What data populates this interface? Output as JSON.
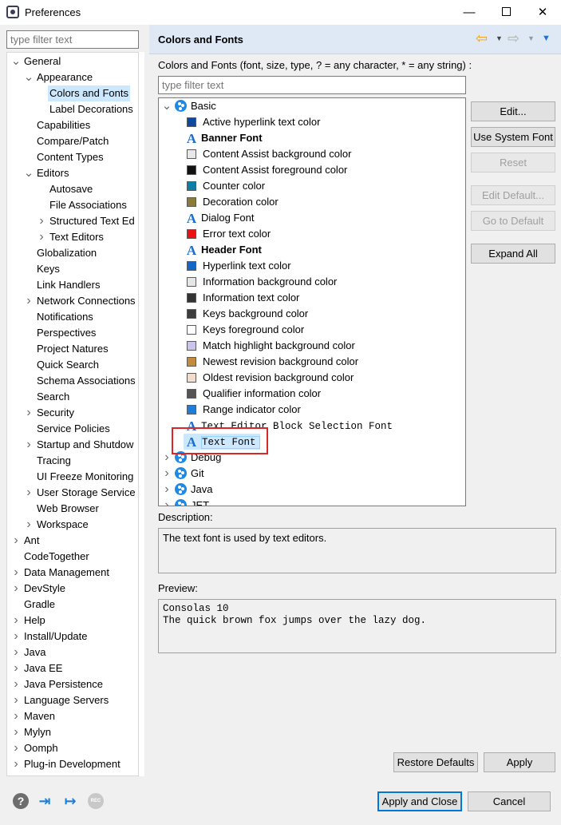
{
  "window": {
    "title": "Preferences",
    "minimize": "—",
    "close": "✕"
  },
  "left": {
    "filter_placeholder": "type filter text",
    "tree": [
      {
        "label": "General",
        "level": 0,
        "toggle": "open"
      },
      {
        "label": "Appearance",
        "level": 1,
        "toggle": "open"
      },
      {
        "label": "Colors and Fonts",
        "level": 2,
        "toggle": "none",
        "selected": true
      },
      {
        "label": "Label Decorations",
        "level": 2,
        "toggle": "none"
      },
      {
        "label": "Capabilities",
        "level": 1,
        "toggle": "none"
      },
      {
        "label": "Compare/Patch",
        "level": 1,
        "toggle": "none"
      },
      {
        "label": "Content Types",
        "level": 1,
        "toggle": "none"
      },
      {
        "label": "Editors",
        "level": 1,
        "toggle": "open"
      },
      {
        "label": "Autosave",
        "level": 2,
        "toggle": "none"
      },
      {
        "label": "File Associations",
        "level": 2,
        "toggle": "none"
      },
      {
        "label": "Structured Text Ed",
        "level": 2,
        "toggle": "closed"
      },
      {
        "label": "Text Editors",
        "level": 2,
        "toggle": "closed"
      },
      {
        "label": "Globalization",
        "level": 1,
        "toggle": "none"
      },
      {
        "label": "Keys",
        "level": 1,
        "toggle": "none"
      },
      {
        "label": "Link Handlers",
        "level": 1,
        "toggle": "none"
      },
      {
        "label": "Network Connections",
        "level": 1,
        "toggle": "closed"
      },
      {
        "label": "Notifications",
        "level": 1,
        "toggle": "none"
      },
      {
        "label": "Perspectives",
        "level": 1,
        "toggle": "none"
      },
      {
        "label": "Project Natures",
        "level": 1,
        "toggle": "none"
      },
      {
        "label": "Quick Search",
        "level": 1,
        "toggle": "none"
      },
      {
        "label": "Schema Associations",
        "level": 1,
        "toggle": "none"
      },
      {
        "label": "Search",
        "level": 1,
        "toggle": "none"
      },
      {
        "label": "Security",
        "level": 1,
        "toggle": "closed"
      },
      {
        "label": "Service Policies",
        "level": 1,
        "toggle": "none"
      },
      {
        "label": "Startup and Shutdow",
        "level": 1,
        "toggle": "closed"
      },
      {
        "label": "Tracing",
        "level": 1,
        "toggle": "none"
      },
      {
        "label": "UI Freeze Monitoring",
        "level": 1,
        "toggle": "none"
      },
      {
        "label": "User Storage Service",
        "level": 1,
        "toggle": "closed"
      },
      {
        "label": "Web Browser",
        "level": 1,
        "toggle": "none"
      },
      {
        "label": "Workspace",
        "level": 1,
        "toggle": "closed"
      },
      {
        "label": "Ant",
        "level": 0,
        "toggle": "closed"
      },
      {
        "label": "CodeTogether",
        "level": 0,
        "toggle": "none"
      },
      {
        "label": "Data Management",
        "level": 0,
        "toggle": "closed"
      },
      {
        "label": "DevStyle",
        "level": 0,
        "toggle": "closed"
      },
      {
        "label": "Gradle",
        "level": 0,
        "toggle": "none"
      },
      {
        "label": "Help",
        "level": 0,
        "toggle": "closed"
      },
      {
        "label": "Install/Update",
        "level": 0,
        "toggle": "closed"
      },
      {
        "label": "Java",
        "level": 0,
        "toggle": "closed"
      },
      {
        "label": "Java EE",
        "level": 0,
        "toggle": "closed"
      },
      {
        "label": "Java Persistence",
        "level": 0,
        "toggle": "closed"
      },
      {
        "label": "Language Servers",
        "level": 0,
        "toggle": "closed"
      },
      {
        "label": "Maven",
        "level": 0,
        "toggle": "closed"
      },
      {
        "label": "Mylyn",
        "level": 0,
        "toggle": "closed"
      },
      {
        "label": "Oomph",
        "level": 0,
        "toggle": "closed"
      },
      {
        "label": "Plug-in Development",
        "level": 0,
        "toggle": "closed"
      }
    ]
  },
  "page": {
    "title": "Colors and Fonts",
    "back_icon": "⇦",
    "forward_icon": "⇨",
    "menu_icon": "▼",
    "description_line": "Colors and Fonts (font, size, type, ? = any character, * = any string) :",
    "filter_placeholder": "type filter text"
  },
  "colors_tree": [
    {
      "label": "Basic",
      "kind": "category",
      "toggle": "open"
    },
    {
      "label": "Active hyperlink text color",
      "kind": "color",
      "color": "#0d4a9e"
    },
    {
      "label": "Banner Font",
      "kind": "font",
      "bold": true
    },
    {
      "label": "Content Assist background color",
      "kind": "color",
      "color": "#e8e8e8"
    },
    {
      "label": "Content Assist foreground color",
      "kind": "color",
      "color": "#111111"
    },
    {
      "label": "Counter color",
      "kind": "color",
      "color": "#0b7fa6"
    },
    {
      "label": "Decoration color",
      "kind": "color",
      "color": "#8c7a3a"
    },
    {
      "label": "Dialog Font",
      "kind": "font"
    },
    {
      "label": "Error text color",
      "kind": "color",
      "color": "#ee1111"
    },
    {
      "label": "Header Font",
      "kind": "font",
      "bold": true
    },
    {
      "label": "Hyperlink text color",
      "kind": "color",
      "color": "#1268c9"
    },
    {
      "label": "Information background color",
      "kind": "color",
      "color": "#e6e6e6"
    },
    {
      "label": "Information text color",
      "kind": "color",
      "color": "#333333"
    },
    {
      "label": "Keys background color",
      "kind": "color",
      "color": "#3c3c3c"
    },
    {
      "label": "Keys foreground color",
      "kind": "color",
      "color": "#ffffff"
    },
    {
      "label": "Match highlight background color",
      "kind": "color",
      "color": "#c8c6ef"
    },
    {
      "label": "Newest revision background color",
      "kind": "color",
      "color": "#c48a3e"
    },
    {
      "label": "Oldest revision background color",
      "kind": "color",
      "color": "#f2dccb"
    },
    {
      "label": "Qualifier information color",
      "kind": "color",
      "color": "#555555"
    },
    {
      "label": "Range indicator color",
      "kind": "color",
      "color": "#1f7fd8"
    },
    {
      "label": "Text Editor Block Selection Font",
      "kind": "font",
      "mono": true
    },
    {
      "label": "Text Font",
      "kind": "font",
      "mono": true,
      "selected": true
    },
    {
      "label": "Debug",
      "kind": "category",
      "toggle": "closed"
    },
    {
      "label": "Git",
      "kind": "category",
      "toggle": "closed"
    },
    {
      "label": "Java",
      "kind": "category",
      "toggle": "closed"
    },
    {
      "label": "JET",
      "kind": "category",
      "toggle": "closed"
    }
  ],
  "buttons": {
    "edit": "Edit...",
    "use_system_font": "Use System Font",
    "reset": "Reset",
    "edit_default": "Edit Default...",
    "go_to_default": "Go to Default",
    "expand_all": "Expand All",
    "restore_defaults": "Restore Defaults",
    "apply": "Apply",
    "apply_and_close": "Apply and Close",
    "cancel": "Cancel"
  },
  "description": {
    "label": "Description:",
    "text": "The text font is used by text editors."
  },
  "preview": {
    "label": "Preview:",
    "line1": "Consolas 10",
    "line2": "The quick brown fox jumps over the lazy dog."
  },
  "bottom_icons": {
    "help": "?",
    "import": "⇥",
    "export": "↦",
    "rec": "REC"
  },
  "icons": {
    "palette": "palette-icon",
    "font": "font-icon",
    "color": "color-swatch-icon"
  }
}
